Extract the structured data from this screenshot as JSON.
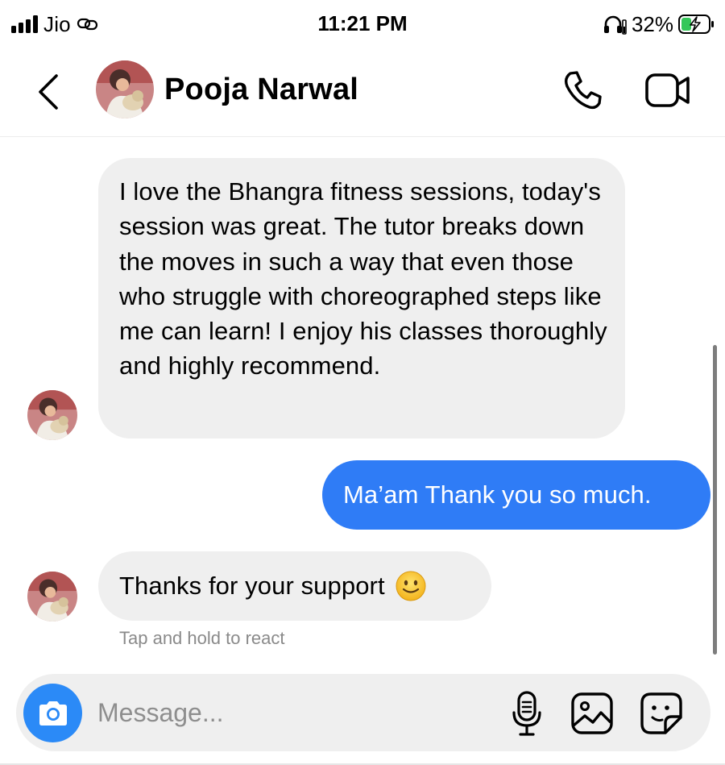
{
  "status_bar": {
    "carrier": "Jio",
    "time": "11:21 PM",
    "battery_percent": "32%",
    "icons": [
      "signal-icon",
      "link-icon",
      "headphones-icon",
      "battery-charging-icon"
    ]
  },
  "header": {
    "contact_name": "Pooja Narwal",
    "icons": [
      "back-arrow-icon",
      "phone-icon",
      "video-camera-icon"
    ]
  },
  "messages": [
    {
      "direction": "incoming",
      "text": "I love the Bhangra fitness sessions, today's session was great. The tutor breaks down the moves in such a way that even those who struggle with choreographed steps like me can learn! I enjoy his classes thoroughly and highly recommend."
    },
    {
      "direction": "outgoing",
      "text": "Ma’am Thank you so much."
    },
    {
      "direction": "incoming",
      "text": "Thanks for your support",
      "emoji": "slightly-smiling-face"
    }
  ],
  "reaction_hint": "Tap and hold to react",
  "composer": {
    "placeholder": "Message...",
    "value": "",
    "icons": [
      "camera-icon",
      "microphone-icon",
      "gallery-icon",
      "sticker-icon"
    ]
  },
  "colors": {
    "outgoing_bubble": "#2f7cf6",
    "incoming_bubble": "#efefef",
    "camera_button": "#2b8af7",
    "battery_charging": "#34c759"
  }
}
